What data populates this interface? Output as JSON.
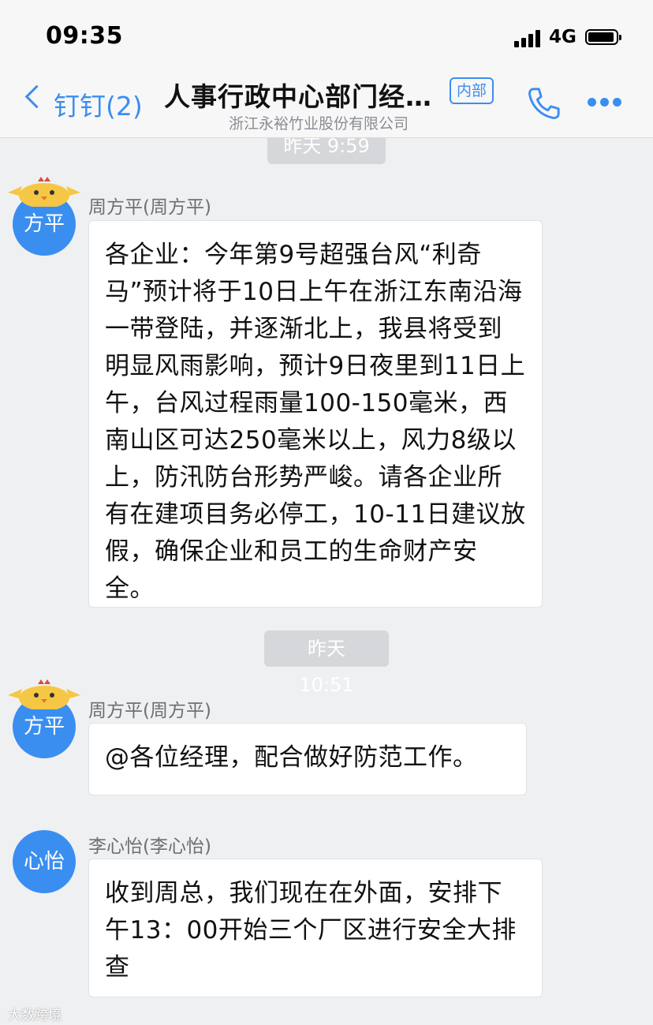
{
  "status_bar": {
    "time": "09:35",
    "network": "4G"
  },
  "header": {
    "back_label": "钉钉(2)",
    "title": "人事行政中心部门经…",
    "badge": "内部",
    "subtitle": "浙江永裕竹业股份有限公司"
  },
  "icons": {
    "back": "chevron-left-icon",
    "phone": "phone-icon",
    "more": "more-dots-icon",
    "mascot": "chick-mascot-icon"
  },
  "colors": {
    "accent": "#3a8ef0",
    "background": "#eff0f2",
    "timestamp_bg": "#d6d7da"
  },
  "messages": {
    "ts1": "昨天 9:59",
    "msg1": {
      "avatar": "方平",
      "sender": "周方平(周方平)",
      "text": "各企业：今年第9号超强台风“利奇马”预计将于10日上午在浙江东南沿海一带登陆，并逐渐北上，我县将受到明显风雨影响，预计9日夜里到11日上午，台风过程雨量100-150毫米，西南山区可达250毫米以上，风力8级以上，防汛防台形势严峻。请各企业所有在建项目务必停工，10-11日建议放假，确保企业和员工的生命财产安全。"
    },
    "ts2": "昨天 10:51",
    "msg2": {
      "avatar": "方平",
      "sender": "周方平(周方平)",
      "text": "@各位经理，配合做好防范工作。"
    },
    "msg3": {
      "avatar": "心怡",
      "sender": "李心怡(李心怡)",
      "text": "收到周总，我们现在在外面，安排下午13：00开始三个厂区进行安全大排查"
    }
  },
  "watermark": "大数跨境"
}
